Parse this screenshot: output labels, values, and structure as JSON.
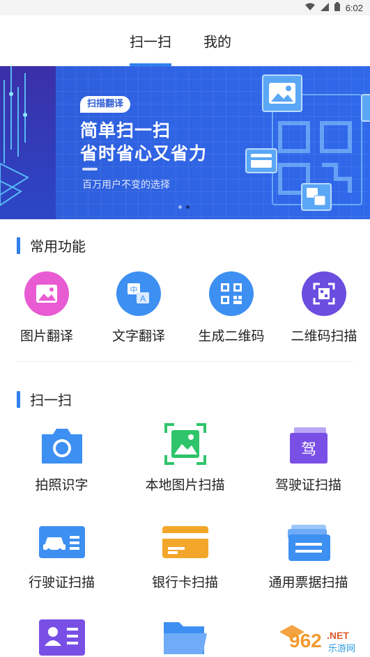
{
  "status_bar": {
    "time": "6:02"
  },
  "tabs": [
    {
      "label": "扫一扫",
      "active": true
    },
    {
      "label": "我的",
      "active": false
    }
  ],
  "banner": {
    "badge": "扫描翻译",
    "title_line1": "简单扫一扫",
    "title_line2": "省时省心又省力",
    "subtitle": "百万用户不变的选择",
    "page_indicator": {
      "count": 2,
      "active_index": 1
    }
  },
  "common_section": {
    "title": "常用功能",
    "items": [
      {
        "label": "图片翻译",
        "icon": "image-icon",
        "color": "#e85bd2"
      },
      {
        "label": "文字翻译",
        "icon": "translate-icon",
        "color": "#3d8ff2"
      },
      {
        "label": "生成二维码",
        "icon": "qr-code-icon",
        "color": "#3d8ff2"
      },
      {
        "label": "二维码扫描",
        "icon": "qr-scan-icon",
        "color": "#6b4de0"
      }
    ]
  },
  "scan_section": {
    "title": "扫一扫",
    "items": [
      {
        "label": "拍照识字",
        "icon": "camera-icon",
        "color": "#3d8ff2"
      },
      {
        "label": "本地图片扫描",
        "icon": "local-image-scan-icon",
        "color": "#2fc46b"
      },
      {
        "label": "驾驶证扫描",
        "icon": "driver-license-icon",
        "color": "#7a4fe6",
        "glyph": "驾"
      },
      {
        "label": "行驶证扫描",
        "icon": "vehicle-license-icon",
        "color": "#3d8ff2"
      },
      {
        "label": "银行卡扫描",
        "icon": "bank-card-icon",
        "color": "#f3a72a"
      },
      {
        "label": "通用票据扫描",
        "icon": "receipt-icon",
        "color": "#3d8ff2"
      },
      {
        "label": "",
        "icon": "id-card-icon",
        "color": "#7a4fe6"
      },
      {
        "label": "",
        "icon": "folder-icon",
        "color": "#3d8ff2"
      }
    ]
  },
  "watermark": {
    "text_main": "962",
    "text_net": ".NET",
    "text_sub": "乐游网"
  }
}
